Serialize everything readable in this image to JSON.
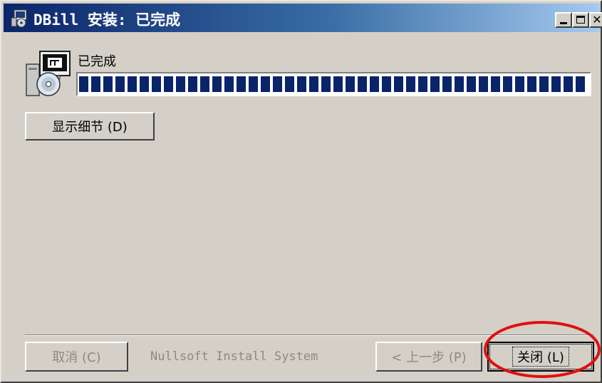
{
  "window": {
    "title": "DBill 安装: 已完成",
    "minimize_glyph": "_",
    "maximize_glyph": "□",
    "close_glyph": "✕"
  },
  "status": {
    "label": "已完成",
    "progress": 1.0,
    "segments": 42
  },
  "buttons": {
    "details": "显示细节 (D)",
    "cancel": "取消 (C)",
    "back": "< 上一步 (P)",
    "close": "关闭 (L)"
  },
  "branding": "Nullsoft Install System",
  "colors": {
    "title_start": "#0a246a",
    "progress_fill": "#0a246a",
    "annotation_circle": "#e01010"
  },
  "icons": {
    "app": "installer-icon",
    "setup": "setup-disc-icon"
  }
}
